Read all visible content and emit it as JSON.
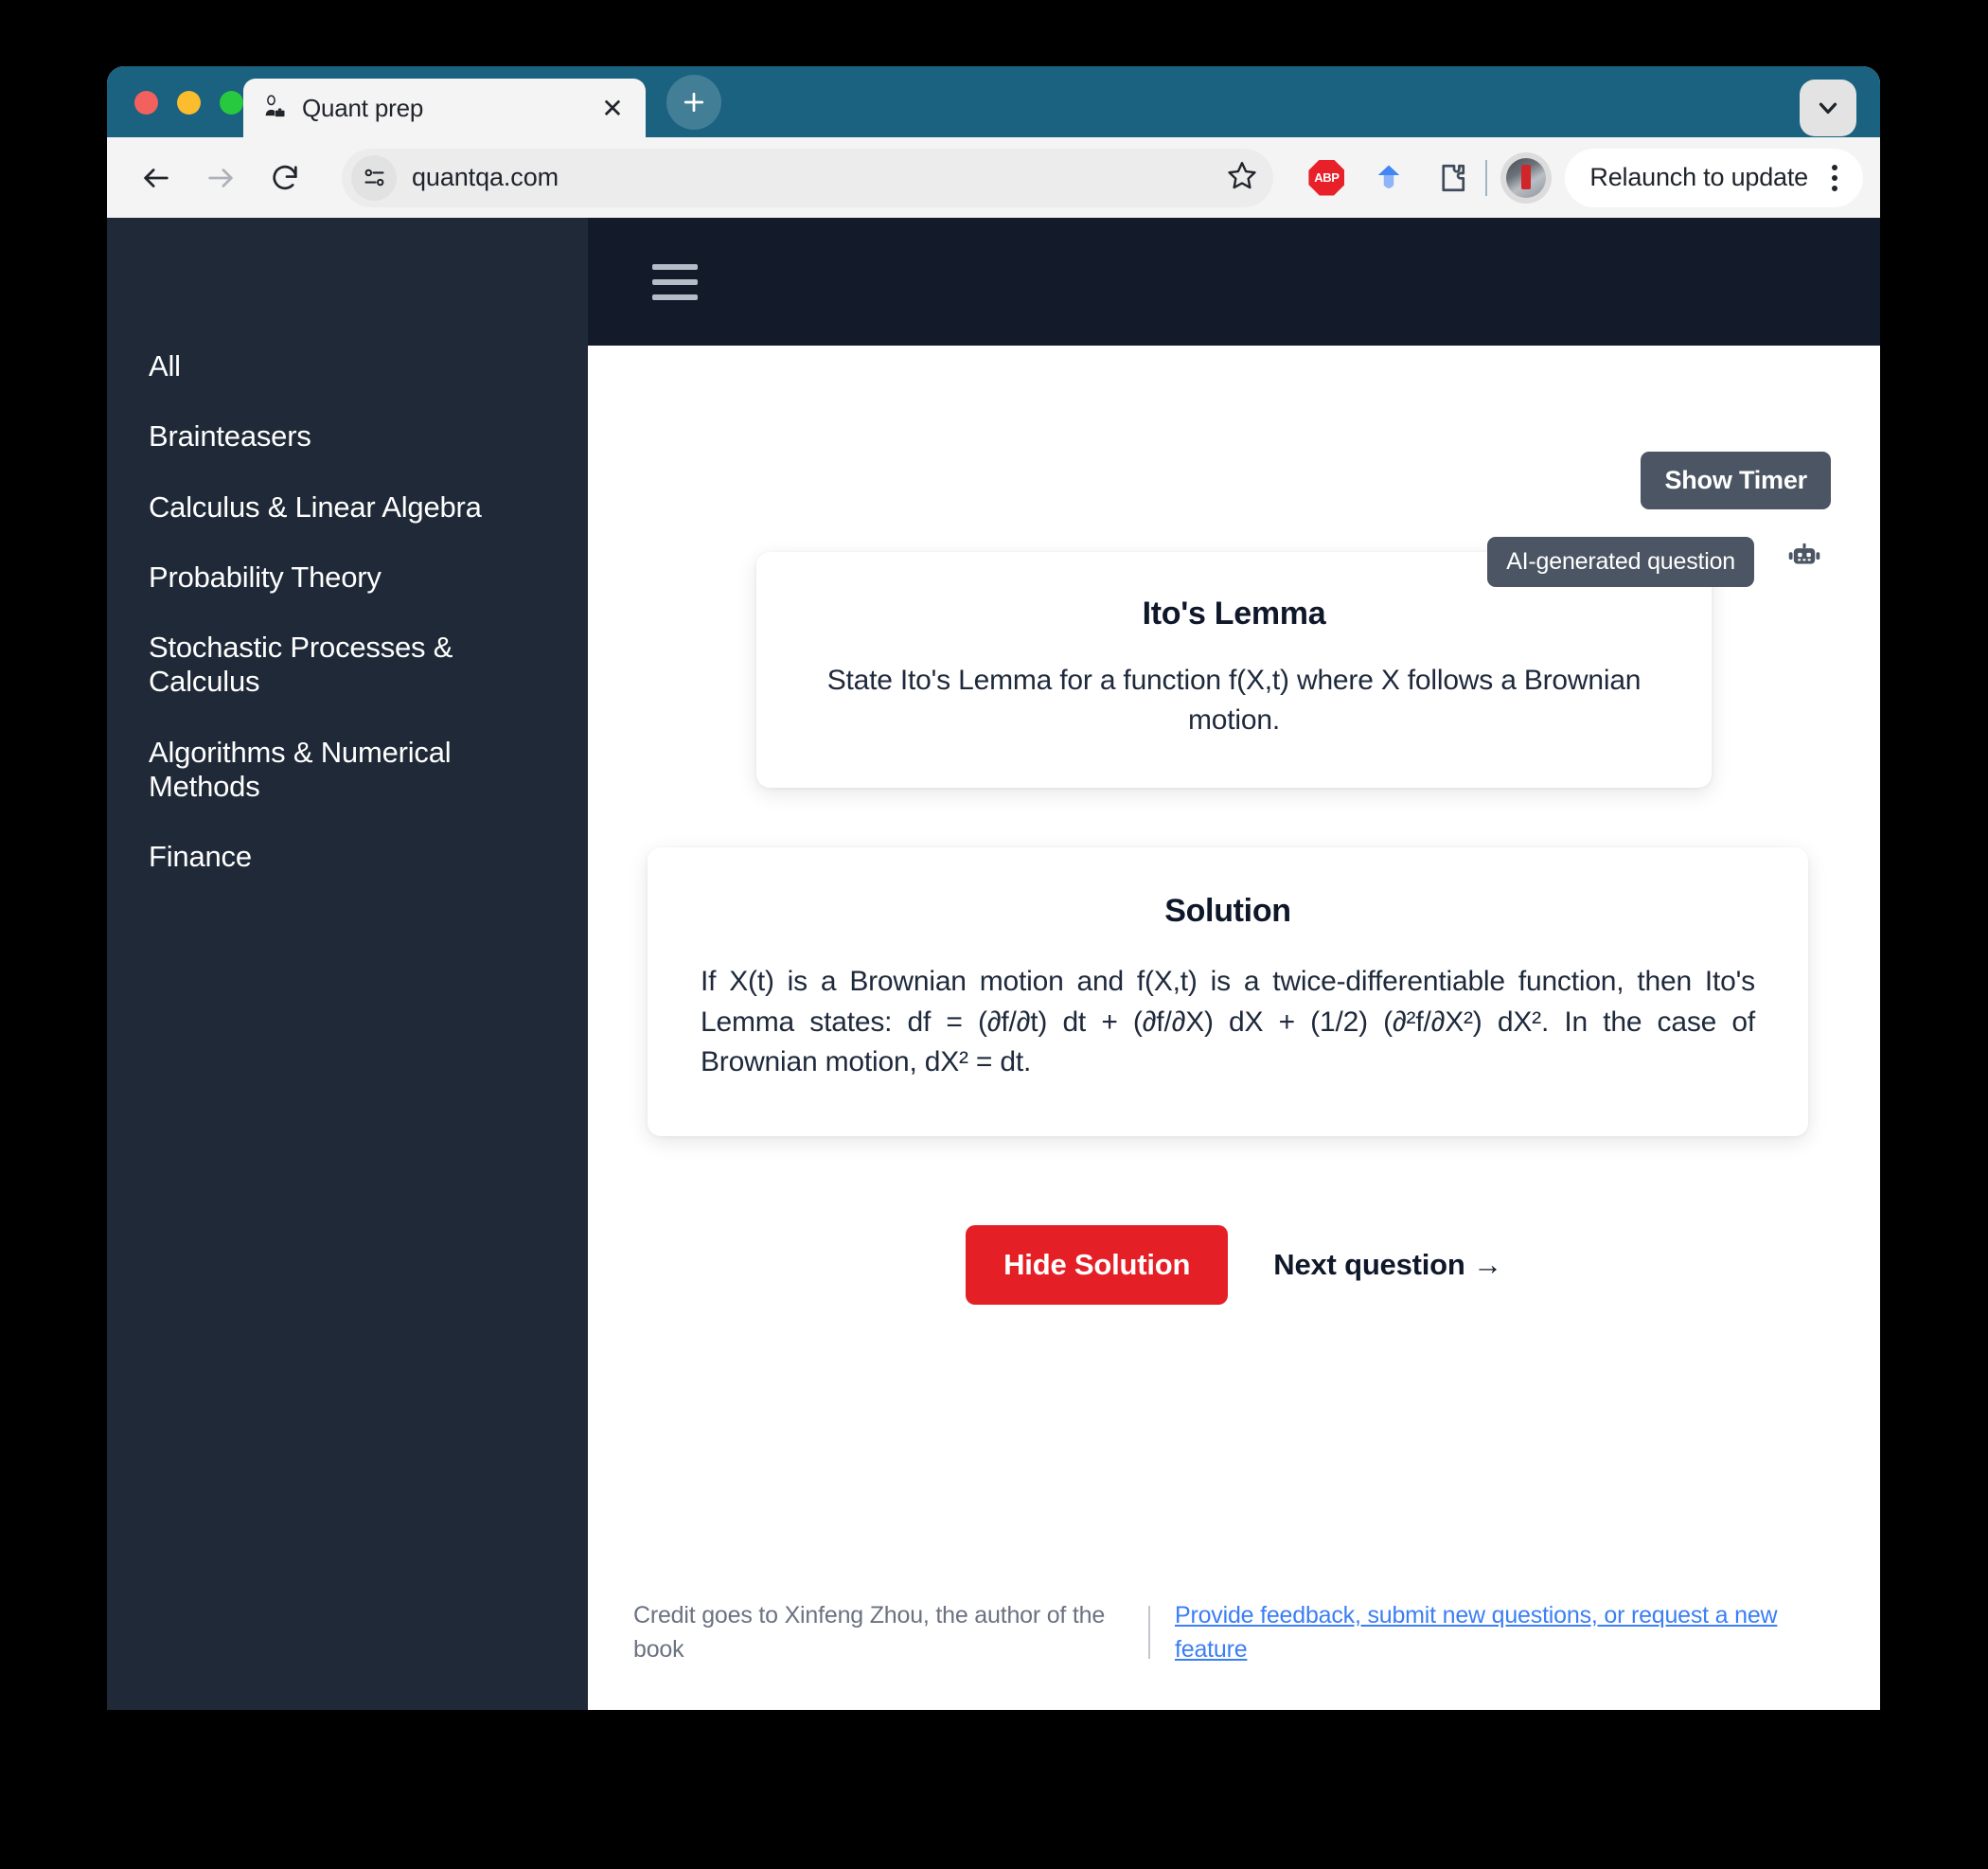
{
  "browser": {
    "tab": {
      "title": "Quant prep",
      "favicon": "businessperson-icon",
      "close_label": "✕"
    },
    "new_tab_label": "+",
    "window_chevron": "chevron-down-icon",
    "toolbar": {
      "back": "back-arrow-icon",
      "forward": "forward-arrow-icon",
      "reload": "reload-icon",
      "site_info": "tune-icon",
      "url": "quantqa.com",
      "bookmark": "star-icon",
      "extensions": [
        "abp-icon",
        "diamond-icon",
        "puzzle-icon"
      ],
      "abp_label": "ABP",
      "profile": "avatar",
      "update_label": "Relaunch to update",
      "menu": "kebab-menu-icon"
    }
  },
  "sidebar": {
    "items": [
      {
        "label": "All"
      },
      {
        "label": "Brainteasers"
      },
      {
        "label": "Calculus & Linear Algebra"
      },
      {
        "label": "Probability Theory"
      },
      {
        "label": "Stochastic Processes & Calculus"
      },
      {
        "label": "Algorithms & Numerical Methods"
      },
      {
        "label": "Finance"
      }
    ]
  },
  "app_header": {
    "menu_icon": "hamburger-icon"
  },
  "main": {
    "timer_button": "Show Timer",
    "ai_badge": "AI-generated question",
    "ai_icon": "robot-icon",
    "question": {
      "title": "Ito's Lemma",
      "text": "State Ito's Lemma for a function f(X,t) where X follows a Brownian motion."
    },
    "solution": {
      "title": "Solution",
      "text": "If X(t) is a Brownian motion and f(X,t) is a twice-differentiable function, then Ito's Lemma states: df = (∂f/∂t) dt + (∂f/∂X) dX + (1/2) (∂²f/∂X²) dX². In the case of Brownian motion, dX² = dt."
    },
    "actions": {
      "hide_solution": "Hide Solution",
      "next_question": "Next question →"
    }
  },
  "footer": {
    "credit": "Credit goes to Xinfeng Zhou, the author of the book",
    "link": "Provide feedback, submit new questions, or request a new feature"
  },
  "colors": {
    "tabstrip": "#1a6280",
    "sidebar": "#1f2937",
    "app_header": "#131b2a",
    "danger": "#e41f26",
    "dark_button": "#4b5563",
    "link": "#3b7ef5"
  }
}
